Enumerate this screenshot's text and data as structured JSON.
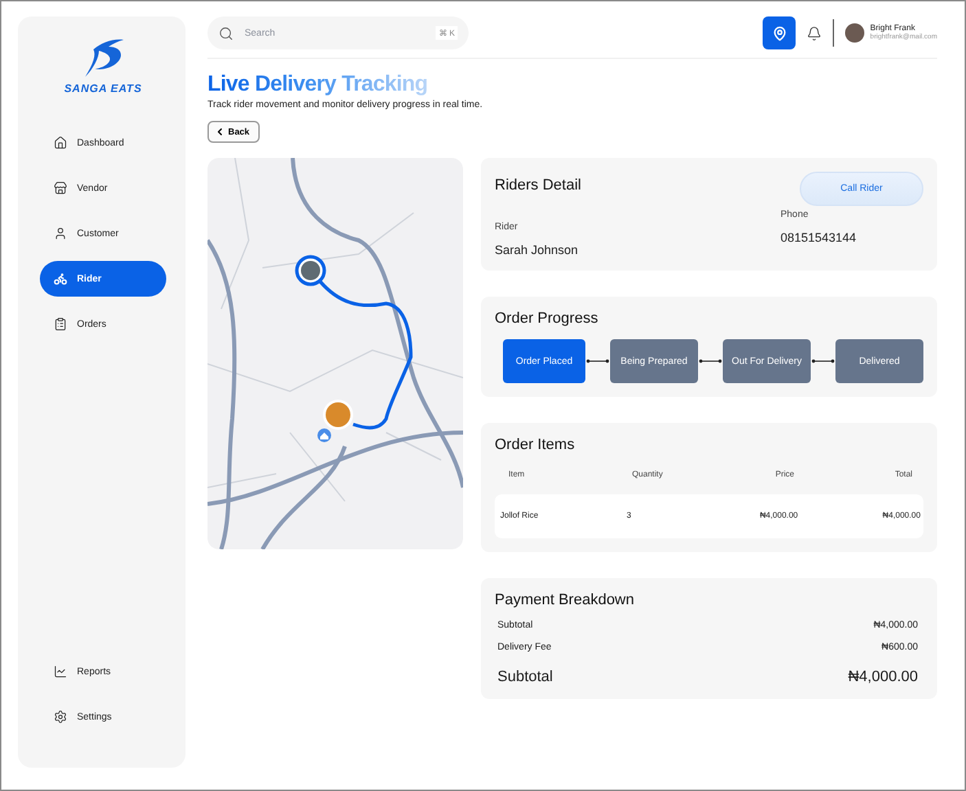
{
  "sidebar": {
    "logo_text": "SANGA EATS",
    "items": [
      {
        "label": "Dashboard",
        "selected": false
      },
      {
        "label": "Vendor",
        "selected": false
      },
      {
        "label": "Customer",
        "selected": false
      },
      {
        "label": "Rider",
        "selected": true
      },
      {
        "label": "Orders",
        "selected": false
      }
    ],
    "bottom_items": [
      {
        "label": "Reports",
        "selected": false
      },
      {
        "label": "Settings",
        "selected": false
      }
    ]
  },
  "header": {
    "search": {
      "placeholder": "Search",
      "shortcut": "⌘ K"
    },
    "user": {
      "name": "Bright Frank",
      "email": "brightfrank@mail.com"
    }
  },
  "page": {
    "title": "Live Delivery Tracking",
    "subtitle": "Track rider movement and monitor delivery progress in real time.",
    "back_label": "Back"
  },
  "rider_detail": {
    "title": "Riders Detail",
    "call_label": "Call Rider",
    "rider_label": "Rider",
    "rider_name": "Sarah Johnson",
    "phone_label": "Phone",
    "phone": "08151543144"
  },
  "order_progress": {
    "title": "Order Progress",
    "steps": [
      {
        "label": "Order Placed",
        "selected": true
      },
      {
        "label": "Being Prepared",
        "selected": false
      },
      {
        "label": "Out For Delivery",
        "selected": false
      },
      {
        "label": "Delivered",
        "selected": false
      }
    ]
  },
  "order_items": {
    "title": "Order Items",
    "columns": [
      "Item",
      "Quantity",
      "Price",
      "Total"
    ],
    "rows": [
      [
        "Jollof Rice",
        "3",
        "₦4,000.00",
        "₦4,000.00"
      ]
    ]
  },
  "payment": {
    "title": "Payment Breakdown",
    "lines": [
      {
        "label": "Subtotal",
        "amount": "₦4,000.00",
        "kind": "line"
      },
      {
        "label": "Delivery Fee",
        "amount": "₦600.00",
        "kind": "line"
      },
      {
        "label": "Subtotal",
        "amount": "₦4,000.00",
        "kind": "total"
      }
    ]
  }
}
